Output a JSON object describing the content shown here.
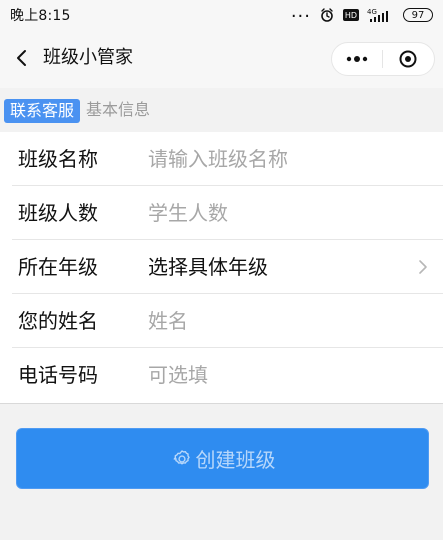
{
  "status_bar": {
    "time": "晚上8:15",
    "icons": [
      "more-dots",
      "alarm-icon",
      "hd-icon",
      "signal-icon",
      "battery-icon"
    ],
    "hd_label": "HD",
    "signal_label": "4G",
    "battery_level": "97"
  },
  "nav": {
    "title": "班级小管家",
    "back_icon": "chevron-left-icon",
    "more_icon": "more-icon",
    "close_icon": "target-icon"
  },
  "section": {
    "service_label": "联系客服",
    "title": "基本信息"
  },
  "form": {
    "rows": [
      {
        "label": "班级名称",
        "placeholder": "请输入班级名称",
        "value": ""
      },
      {
        "label": "班级人数",
        "placeholder": "学生人数",
        "value": ""
      },
      {
        "label": "所在年级",
        "value": "选择具体年级"
      },
      {
        "label": "您的姓名",
        "placeholder": "姓名",
        "value": ""
      },
      {
        "label": "电话号码",
        "placeholder": "可选填",
        "value": ""
      }
    ]
  },
  "actions": {
    "create_label": "创建班级"
  },
  "colors": {
    "primary": "#2f8cf0",
    "primary_light": "#4a92f1",
    "text": "#111111",
    "placeholder": "#a7a7a7",
    "background": "#f2f2f2"
  }
}
